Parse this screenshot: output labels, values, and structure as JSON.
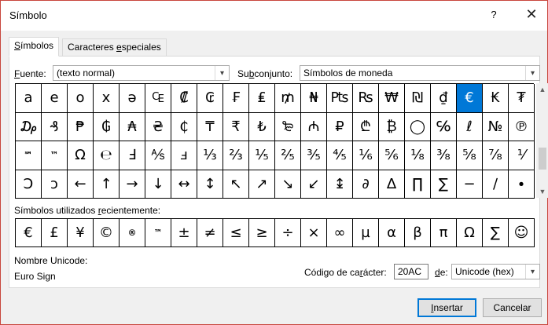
{
  "window": {
    "title": "Símbolo",
    "help_label": "?",
    "close_label": "✕"
  },
  "tabs": [
    {
      "label_pre": "",
      "label_u": "S",
      "label_post": "ímbolos",
      "active": true
    },
    {
      "label_pre": "Caracteres ",
      "label_u": "e",
      "label_post": "speciales",
      "active": false
    }
  ],
  "font": {
    "label_u": "F",
    "label_rest": "uente:",
    "value": "(texto normal)"
  },
  "subset": {
    "label_pre": "Su",
    "label_u": "b",
    "label_post": "conjunto:",
    "value": "Símbolos de moneda"
  },
  "symbols": [
    [
      "a",
      "e",
      "o",
      "x",
      "ə",
      "₠",
      "₡",
      "₢",
      "₣",
      "₤",
      "₥",
      "₦",
      "₧",
      "₨",
      "₩",
      "₪",
      "₫",
      "€",
      "₭",
      "₮"
    ],
    [
      "₯",
      "₰",
      "₱",
      "₲",
      "₳",
      "₴",
      "₵",
      "₸",
      "₹",
      "₺",
      "₻",
      "₼",
      "₽",
      "₾",
      "₿",
      "◯",
      "℅",
      "ℓ",
      "№",
      "℗"
    ],
    [
      "℠",
      "™",
      "Ω",
      "℮",
      "Ⅎ",
      "⅍",
      "ⅎ",
      "⅓",
      "⅔",
      "⅕",
      "⅖",
      "⅗",
      "⅘",
      "⅙",
      "⅚",
      "⅛",
      "⅜",
      "⅝",
      "⅞",
      "⅟"
    ],
    [
      "Ↄ",
      "ↄ",
      "←",
      "↑",
      "→",
      "↓",
      "↔",
      "↕",
      "↖",
      "↗",
      "↘",
      "↙",
      "↨",
      "∂",
      "∆",
      "∏",
      "∑",
      "−",
      "∕",
      "∙"
    ]
  ],
  "selected_symbol": "€",
  "recent": {
    "label_pre": "Símbolos utilizados ",
    "label_u": "r",
    "label_post": "ecientemente:",
    "symbols": [
      "€",
      "£",
      "¥",
      "©",
      "®",
      "™",
      "±",
      "≠",
      "≤",
      "≥",
      "÷",
      "×",
      "∞",
      "µ",
      "α",
      "β",
      "π",
      "Ω",
      "∑",
      "☺"
    ]
  },
  "unicode_name": {
    "label": "Nombre Unicode:",
    "value": "Euro Sign"
  },
  "char_code": {
    "label_pre": "Código de ca",
    "label_u": "r",
    "label_post": "ácter:",
    "value": "20AC"
  },
  "from": {
    "label_u": "d",
    "label_post": "e:",
    "value": "Unicode (hex)"
  },
  "buttons": {
    "insert_u": "I",
    "insert_rest": "nsertar",
    "cancel": "Cancelar"
  }
}
